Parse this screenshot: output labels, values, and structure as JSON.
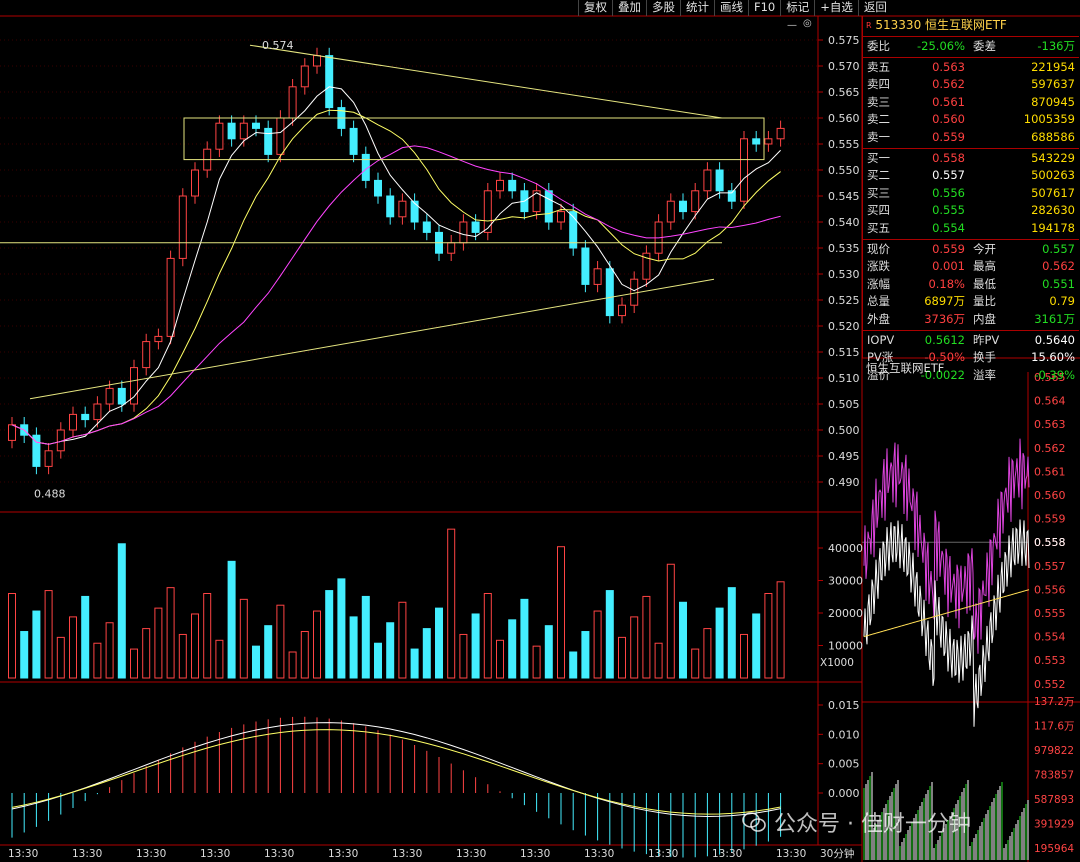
{
  "toolbar": [
    "复权",
    "叠加",
    "多股",
    "统计",
    "画线",
    "F10",
    "标记",
    "+自选",
    "返回"
  ],
  "ctl": {
    "minus": "—",
    "close": "◎"
  },
  "quote": {
    "code_name": "513330 恒生互联网ETF",
    "rmark": "R",
    "weibi_label": "委比",
    "weibi": "-25.06%",
    "weicha_label": "委差",
    "weicha": "-136万",
    "asks": [
      {
        "label": "卖五",
        "price": "0.563",
        "vol": "221954"
      },
      {
        "label": "卖四",
        "price": "0.562",
        "vol": "597637"
      },
      {
        "label": "卖三",
        "price": "0.561",
        "vol": "870945"
      },
      {
        "label": "卖二",
        "price": "0.560",
        "vol": "1005359"
      },
      {
        "label": "卖一",
        "price": "0.559",
        "vol": "688586"
      }
    ],
    "bids": [
      {
        "label": "买一",
        "price": "0.558",
        "vol": "543229"
      },
      {
        "label": "买二",
        "price": "0.557",
        "vol": "500263"
      },
      {
        "label": "买三",
        "price": "0.556",
        "vol": "507617"
      },
      {
        "label": "买四",
        "price": "0.555",
        "vol": "282630"
      },
      {
        "label": "买五",
        "price": "0.554",
        "vol": "194178"
      }
    ],
    "stats": [
      {
        "l1": "现价",
        "v1": "0.559",
        "l2": "今开",
        "v2": "0.557"
      },
      {
        "l1": "涨跌",
        "v1": "0.001",
        "l2": "最高",
        "v2": "0.562"
      },
      {
        "l1": "涨幅",
        "v1": "0.18%",
        "l2": "最低",
        "v2": "0.551"
      },
      {
        "l1": "总量",
        "v1": "6897万",
        "l2": "量比",
        "v2": "0.79"
      },
      {
        "l1": "外盘",
        "v1": "3736万",
        "l2": "内盘",
        "v2": "3161万"
      }
    ],
    "iopv": [
      {
        "l1": "IOPV",
        "v1": "0.5612",
        "l2": "昨PV",
        "v2": "0.5640"
      },
      {
        "l1": "PV涨",
        "v1": "-0.50%",
        "l2": "换手",
        "v2": "15.60%"
      },
      {
        "l1": "溢价",
        "v1": "-0.0022",
        "l2": "溢率",
        "v2": "-0.39%"
      }
    ]
  },
  "mini_title": "恒生互联网ETF",
  "footer_tag": "30分钟",
  "watermark": "公众号 · 佳财一分钟",
  "chart_data": {
    "type": "candlestick",
    "price_axis": [
      "0.575",
      "0.570",
      "0.565",
      "0.560",
      "0.555",
      "0.550",
      "0.545",
      "0.540",
      "0.535",
      "0.530",
      "0.525",
      "0.520",
      "0.515",
      "0.510",
      "0.505",
      "0.500",
      "0.495",
      "0.490"
    ],
    "annotations": [
      {
        "text": "0.574"
      },
      {
        "text": "0.488"
      }
    ],
    "volume_axis": [
      "40000",
      "30000",
      "20000",
      "10000"
    ],
    "volume_unit": "X1000",
    "macd_axis": [
      "0.015",
      "0.010",
      "0.005",
      "0.000"
    ],
    "time_label": "13:30",
    "mini_price_axis": [
      "0.565",
      "0.564",
      "0.563",
      "0.562",
      "0.561",
      "0.560",
      "0.559",
      "0.558",
      "0.557",
      "0.556",
      "0.555",
      "0.554",
      "0.553",
      "0.552"
    ],
    "mini_price_current": "0.558",
    "mini_vol_axis": [
      "137.2万",
      "117.6万",
      "979822",
      "783857",
      "587893",
      "391929",
      "195964"
    ]
  }
}
